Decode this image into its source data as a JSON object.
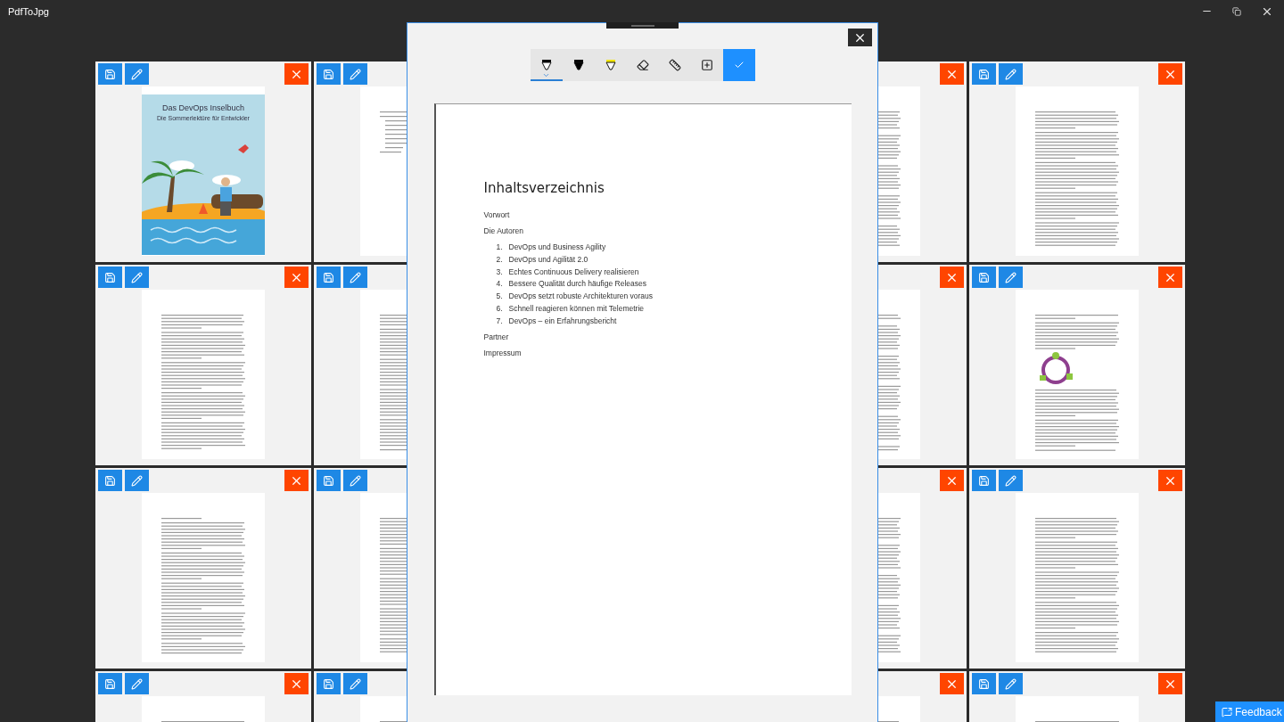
{
  "app": {
    "title": "PdfToJpg"
  },
  "pages": [
    {
      "kind": "cover",
      "title": "Das DevOps Inselbuch",
      "subtitle": "Die Sommerlektüre für Entwickler"
    },
    {
      "kind": "toc"
    },
    {
      "kind": "text"
    },
    {
      "kind": "text"
    },
    {
      "kind": "text"
    },
    {
      "kind": "text"
    },
    {
      "kind": "text"
    },
    {
      "kind": "figure"
    },
    {
      "kind": "text"
    },
    {
      "kind": "text"
    },
    {
      "kind": "text"
    },
    {
      "kind": "text"
    },
    {
      "kind": "text"
    },
    {
      "kind": "text"
    },
    {
      "kind": "text"
    },
    {
      "kind": "text"
    }
  ],
  "editor": {
    "tools": [
      {
        "kind": "pen",
        "selected": true
      },
      {
        "kind": "pencil",
        "selected": false
      },
      {
        "kind": "highlighter",
        "selected": false
      },
      {
        "kind": "eraser",
        "selected": false
      },
      {
        "kind": "ruler",
        "selected": false
      },
      {
        "kind": "crop",
        "selected": false
      }
    ],
    "document": {
      "heading": "Inhaltsverzeichnis",
      "entries": [
        {
          "kind": "entry",
          "text": "Vorwort"
        },
        {
          "kind": "entry",
          "text": "Die Autoren"
        },
        {
          "kind": "chapter",
          "number": "1.",
          "text": "DevOps und Business Agility"
        },
        {
          "kind": "chapter",
          "number": "2.",
          "text": "DevOps und Agilität 2.0"
        },
        {
          "kind": "chapter",
          "number": "3.",
          "text": "Echtes Continuous Delivery realisieren"
        },
        {
          "kind": "chapter",
          "number": "4.",
          "text": "Bessere Qualität durch häufige Releases"
        },
        {
          "kind": "chapter",
          "number": "5.",
          "text": "DevOps setzt robuste Architekturen voraus"
        },
        {
          "kind": "chapter",
          "number": "6.",
          "text": "Schnell reagieren können mit Telemetrie"
        },
        {
          "kind": "chapter",
          "number": "7.",
          "text": "DevOps – ein Erfahrungsbericht"
        },
        {
          "kind": "entry",
          "text": "Partner"
        },
        {
          "kind": "entry",
          "text": "Impressum"
        }
      ]
    }
  },
  "feedback": {
    "label": "Feedback"
  }
}
